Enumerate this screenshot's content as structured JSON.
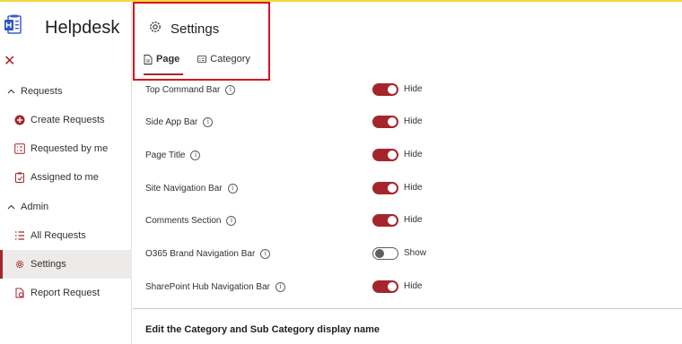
{
  "app": {
    "title": "Helpdesk"
  },
  "sidebar": {
    "close_glyph": "✕",
    "groups": [
      {
        "label": "Requests",
        "items": [
          {
            "label": "Create Requests",
            "icon": "add-circle-icon"
          },
          {
            "label": "Requested by me",
            "icon": "checklist-icon"
          },
          {
            "label": "Assigned to me",
            "icon": "clipboard-icon"
          }
        ]
      },
      {
        "label": "Admin",
        "items": [
          {
            "label": "All Requests",
            "icon": "list-icon"
          },
          {
            "label": "Settings",
            "icon": "gear-icon",
            "active": true
          },
          {
            "label": "Report Request",
            "icon": "report-icon"
          }
        ]
      }
    ]
  },
  "header": {
    "title": "Settings",
    "icon": "gear-icon"
  },
  "tabs": [
    {
      "label": "Page",
      "icon": "page-icon",
      "active": true
    },
    {
      "label": "Category",
      "icon": "category-icon",
      "active": false
    }
  ],
  "settings": [
    {
      "label": "Top Command Bar",
      "state": "Hide",
      "on": true
    },
    {
      "label": "Side App Bar",
      "state": "Hide",
      "on": true
    },
    {
      "label": "Page Title",
      "state": "Hide",
      "on": true
    },
    {
      "label": "Site Navigation Bar",
      "state": "Hide",
      "on": true
    },
    {
      "label": "Comments Section",
      "state": "Hide",
      "on": true
    },
    {
      "label": "O365 Brand Navigation Bar",
      "state": "Show",
      "on": false
    },
    {
      "label": "SharePoint Hub Navigation Bar",
      "state": "Hide",
      "on": true
    }
  ],
  "info_glyph": "i",
  "section": {
    "title": "Edit the Category and Sub Category display name"
  },
  "colors": {
    "accent": "#a4262c",
    "highlight": "#d9141c",
    "top_line": "#f5d63c"
  }
}
